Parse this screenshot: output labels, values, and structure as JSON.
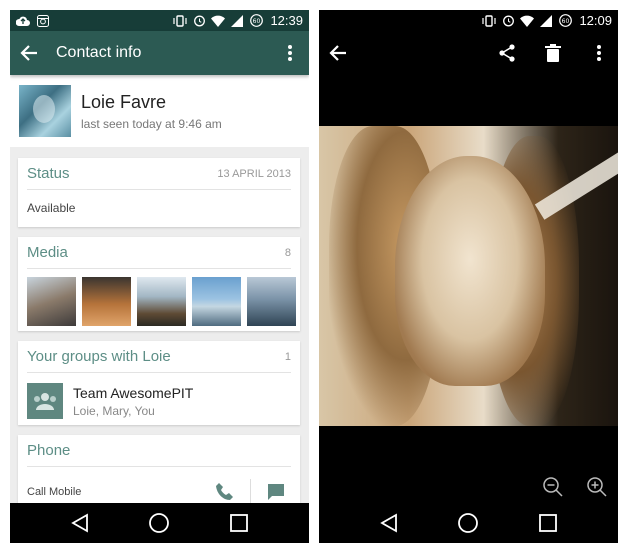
{
  "left": {
    "status_bar": {
      "time": "12:39"
    },
    "app_bar": {
      "title": "Contact info"
    },
    "profile": {
      "name": "Loie Favre",
      "last_seen": "last seen today at 9:46 am"
    },
    "status_card": {
      "title": "Status",
      "date": "13 APRIL 2013",
      "value": "Available"
    },
    "media_card": {
      "title": "Media",
      "count": "8"
    },
    "groups_card": {
      "title": "Your groups with Loie",
      "count": "1",
      "group_name": "Team AwesomePIT",
      "group_members": "Loie, Mary, You"
    },
    "phone_card": {
      "title": "Phone",
      "label": "Call Mobile"
    }
  },
  "right": {
    "status_bar": {
      "time": "12:09"
    }
  },
  "colors": {
    "header": "#2c5a53",
    "statusbar": "#173d38",
    "accent_text": "#5d8e86"
  },
  "icons": [
    "cloud-upload-icon",
    "instagram-icon",
    "vibrate-icon",
    "alarm-icon",
    "wifi-icon",
    "signal-icon",
    "battery-icon",
    "back-arrow-icon",
    "overflow-menu-icon",
    "share-icon",
    "delete-icon",
    "group-icon",
    "phone-icon",
    "message-icon",
    "zoom-out-icon",
    "zoom-in-icon",
    "nav-back-icon",
    "nav-home-icon",
    "nav-recents-icon"
  ]
}
